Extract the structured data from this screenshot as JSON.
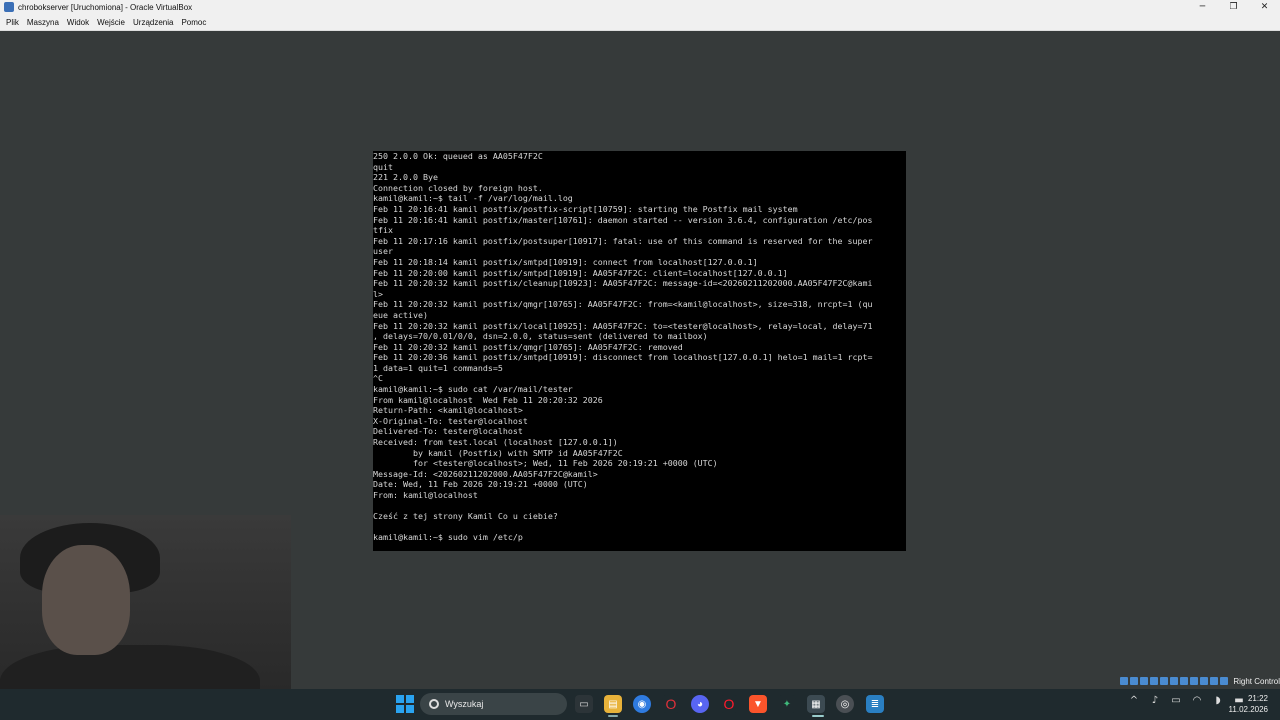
{
  "window": {
    "title": "chrobokserver [Uruchomiona] - Oracle VirtualBox",
    "controls": {
      "minimize": "─",
      "restore": "❐",
      "close": "✕"
    }
  },
  "menu": [
    "Plik",
    "Maszyna",
    "Widok",
    "Wejście",
    "Urządzenia",
    "Pomoc"
  ],
  "terminal": {
    "lines": [
      "250 2.0.0 Ok: queued as AA05F47F2C",
      "quit",
      "221 2.0.0 Bye",
      "Connection closed by foreign host.",
      "kamil@kamil:~$ tail -f /var/log/mail.log",
      "Feb 11 20:16:41 kamil postfix/postfix-script[10759]: starting the Postfix mail system",
      "Feb 11 20:16:41 kamil postfix/master[10761]: daemon started -- version 3.6.4, configuration /etc/pos",
      "tfix",
      "Feb 11 20:17:16 kamil postfix/postsuper[10917]: fatal: use of this command is reserved for the super",
      "user",
      "Feb 11 20:18:14 kamil postfix/smtpd[10919]: connect from localhost[127.0.0.1]",
      "Feb 11 20:20:00 kamil postfix/smtpd[10919]: AA05F47F2C: client=localhost[127.0.0.1]",
      "Feb 11 20:20:32 kamil postfix/cleanup[10923]: AA05F47F2C: message-id=<20260211202000.AA05F47F2C@kami",
      "l>",
      "Feb 11 20:20:32 kamil postfix/qmgr[10765]: AA05F47F2C: from=<kamil@localhost>, size=318, nrcpt=1 (qu",
      "eue active)",
      "Feb 11 20:20:32 kamil postfix/local[10925]: AA05F47F2C: to=<tester@localhost>, relay=local, delay=71",
      ", delays=70/0.01/0/0, dsn=2.0.0, status=sent (delivered to mailbox)",
      "Feb 11 20:20:32 kamil postfix/qmgr[10765]: AA05F47F2C: removed",
      "Feb 11 20:20:36 kamil postfix/smtpd[10919]: disconnect from localhost[127.0.0.1] helo=1 mail=1 rcpt=",
      "1 data=1 quit=1 commands=5",
      "^C",
      "kamil@kamil:~$ sudo cat /var/mail/tester",
      "From kamil@localhost  Wed Feb 11 20:20:32 2026",
      "Return-Path: <kamil@localhost>",
      "X-Original-To: tester@localhost",
      "Delivered-To: tester@localhost",
      "Received: from test.local (localhost [127.0.0.1])",
      "        by kamil (Postfix) with SMTP id AA05F47F2C",
      "        for <tester@localhost>; Wed, 11 Feb 2026 20:19:21 +0000 (UTC)",
      "Message-Id: <20260211202000.AA05F47F2C@kamil>",
      "Date: Wed, 11 Feb 2026 20:19:21 +0000 (UTC)",
      "From: kamil@localhost",
      "",
      "Cześć z tej strony Kamil Co u ciebie?",
      "",
      "kamil@kamil:~$ sudo vim /etc/p"
    ]
  },
  "vbox_status": {
    "label": "Right Control"
  },
  "taskbar": {
    "search_placeholder": "Wyszukaj",
    "clock_time": "21:22",
    "clock_date": "11.02.2026"
  },
  "colors": {
    "vm_background": "#363a3a",
    "taskbar": "#1f2a2e",
    "terminal_bg": "#000000",
    "terminal_fg": "#d8d8d8"
  }
}
